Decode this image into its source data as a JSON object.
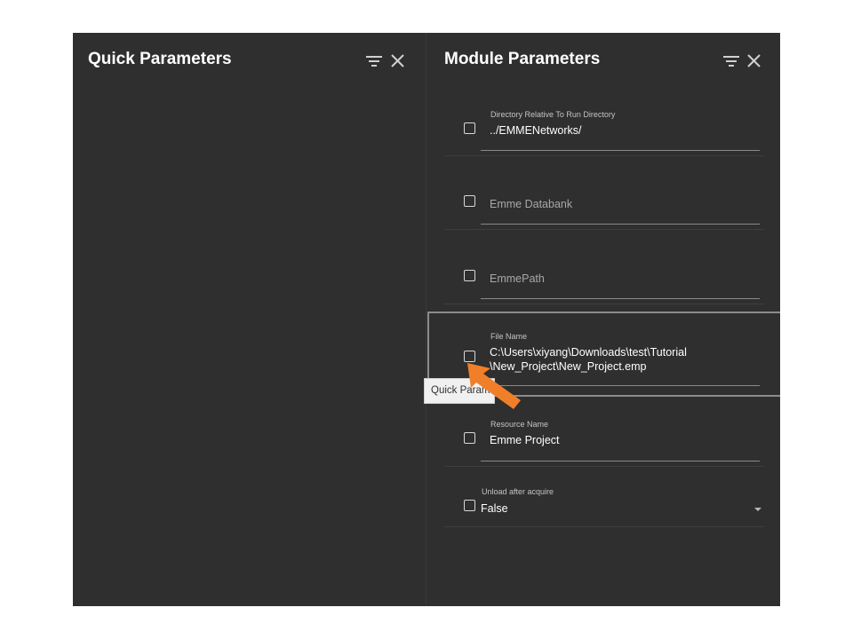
{
  "quick_panel": {
    "title": "Quick Parameters",
    "icons": [
      "filter-icon",
      "close-icon"
    ]
  },
  "module_panel": {
    "title": "Module Parameters",
    "icons": [
      "filter-icon",
      "close-icon"
    ],
    "params": [
      {
        "label": "Directory Relative To Run Directory",
        "value": "../EMMENetworks/",
        "placeholder": ""
      },
      {
        "label": "",
        "value": "",
        "placeholder": "Emme Databank"
      },
      {
        "label": "",
        "value": "",
        "placeholder": "EmmePath"
      },
      {
        "label": "File Name",
        "value_line1": "C:\\Users\\xiyang\\Downloads\\test\\Tutorial",
        "value_line2": "\\New_Project\\New_Project.emp"
      },
      {
        "label": "Resource Name",
        "value": "Emme Project"
      },
      {
        "label": "Unload after acquire",
        "value": "False"
      }
    ]
  },
  "tooltip": {
    "text": "Quick Parameter"
  },
  "colors": {
    "panel_bg": "#2f2f2f",
    "highlight_border": "#8c8c8c",
    "arrow": "#f07f2a"
  }
}
